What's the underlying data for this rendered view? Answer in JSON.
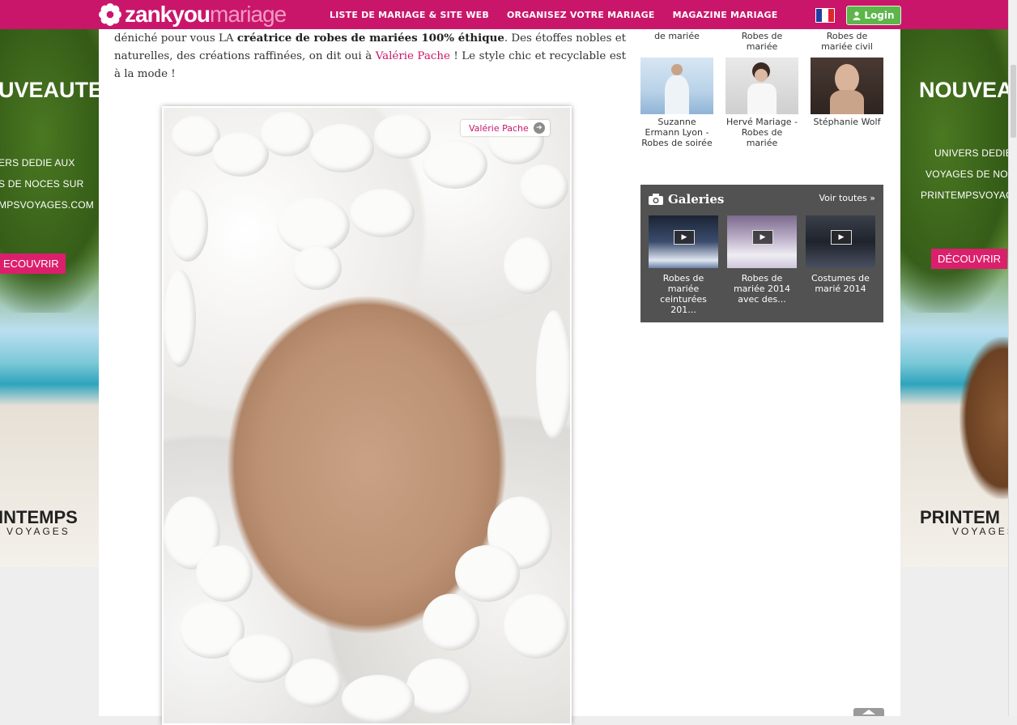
{
  "header": {
    "logo_part1": "zankyou",
    "logo_part2": "mariage",
    "nav": [
      "LISTE DE MARIAGE & SITE WEB",
      "ORGANISEZ VOTRE MARIAGE",
      "MAGAZINE MARIAGE"
    ],
    "login_label": "Login"
  },
  "article": {
    "text_before": "déniché pour vous LA ",
    "text_bold": "créatrice de robes de mariées 100% éthique",
    "text_mid": ". Des étoffes nobles et naturelles, des créations raffinées, on dit oui à ",
    "link_text": "Valérie Pache",
    "text_after": " ! Le style chic et recyclable est à la mode !",
    "photo_tag": "Valérie Pache"
  },
  "sidebar": {
    "top_captions": [
      "de mariée",
      "Robes de mariée",
      "Robes de mariée civil"
    ],
    "thumbs": [
      {
        "caption": "Suzanne Ermann Lyon - Robes de soirée"
      },
      {
        "caption": "Hervé Mariage - Robes de mariée"
      },
      {
        "caption": "Stéphanie Wolf"
      }
    ],
    "galeries": {
      "title": "Galeries",
      "see_all": "Voir toutes »",
      "items": [
        {
          "caption": "Robes de mariée ceinturées 201..."
        },
        {
          "caption": "Robes de mariée 2014 avec des..."
        },
        {
          "caption": "Costumes de marié 2014"
        }
      ]
    }
  },
  "ads": {
    "left": {
      "title": "UVEAUTE",
      "lines": [
        "ERS DEDIE AUX",
        "S DE NOCES SUR",
        "MPSVOYAGES.COM"
      ],
      "cta": "ECOUVRIR",
      "brand": "INTEMPS",
      "brand2": "VOYAGES"
    },
    "right": {
      "title": "NOUVEAU",
      "lines": [
        "UNIVERS DEDIE A",
        "VOYAGES DE NOCES",
        "PRINTEMPSVOYAGES"
      ],
      "cta": "DÉCOUVRIR",
      "brand": "PRINTEM",
      "brand2": "VOYAGES"
    }
  },
  "colors": {
    "brand": "#c9166b",
    "login": "#5cb64a",
    "galeries_bg": "#525252"
  }
}
